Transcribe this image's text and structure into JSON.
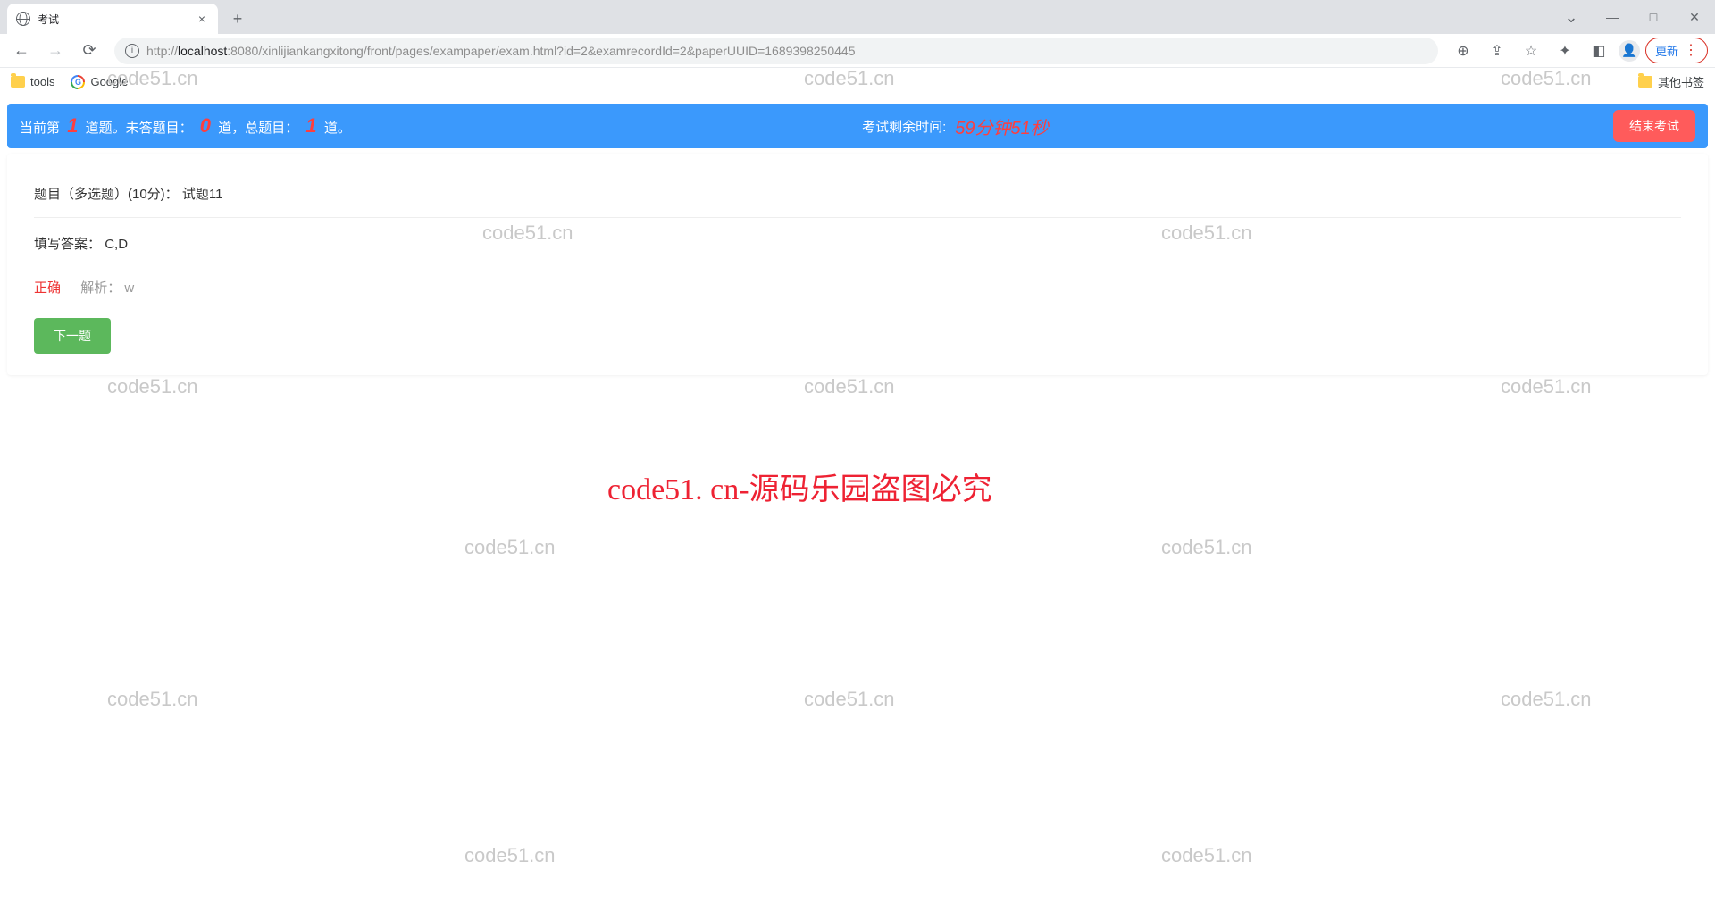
{
  "browser": {
    "tab_title": "考试",
    "url_prefix": "http://",
    "url_host": "localhost",
    "url_rest": ":8080/xinlijiankangxitong/front/pages/exampaper/exam.html?id=2&examrecordId=2&paperUUID=1689398250445",
    "update_label": "更新",
    "bookmarks": {
      "tools": "tools",
      "google": "Google",
      "other": "其他书签"
    }
  },
  "exam": {
    "status_prefix": "当前第",
    "current_num": "1",
    "status_mid1": "道题。未答题目：",
    "unanswered": "0",
    "status_mid2": "道，总题目：",
    "total": "1",
    "status_suffix": "道。",
    "timer_label": "考试剩余时间:",
    "timer_value": "59分钟51秒",
    "end_button": "结束考试"
  },
  "question": {
    "title_label": "题目（多选题）(10分)：",
    "title_text": "试题11",
    "answer_label": "填写答案：",
    "answer_value": "C,D",
    "correct_label": "正确",
    "analysis_label": "解析：",
    "analysis_text": "w",
    "next_button": "下一题"
  },
  "watermark": {
    "small": "code51.cn",
    "big": "code51. cn-源码乐园盗图必究"
  }
}
